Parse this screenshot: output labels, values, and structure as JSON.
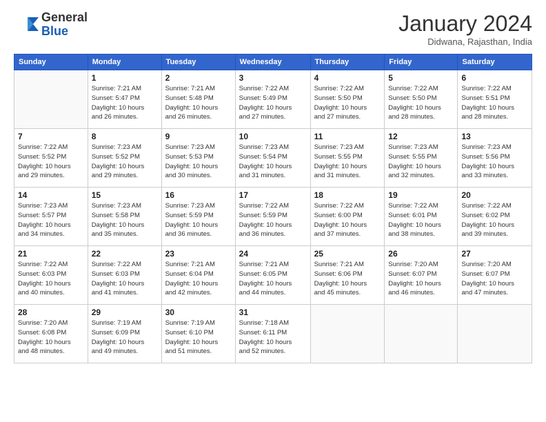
{
  "header": {
    "logo": {
      "line1": "General",
      "line2": "Blue"
    },
    "title": "January 2024",
    "location": "Didwana, Rajasthan, India"
  },
  "weekdays": [
    "Sunday",
    "Monday",
    "Tuesday",
    "Wednesday",
    "Thursday",
    "Friday",
    "Saturday"
  ],
  "weeks": [
    [
      {
        "day": "",
        "info": ""
      },
      {
        "day": "1",
        "info": "Sunrise: 7:21 AM\nSunset: 5:47 PM\nDaylight: 10 hours\nand 26 minutes."
      },
      {
        "day": "2",
        "info": "Sunrise: 7:21 AM\nSunset: 5:48 PM\nDaylight: 10 hours\nand 26 minutes."
      },
      {
        "day": "3",
        "info": "Sunrise: 7:22 AM\nSunset: 5:49 PM\nDaylight: 10 hours\nand 27 minutes."
      },
      {
        "day": "4",
        "info": "Sunrise: 7:22 AM\nSunset: 5:50 PM\nDaylight: 10 hours\nand 27 minutes."
      },
      {
        "day": "5",
        "info": "Sunrise: 7:22 AM\nSunset: 5:50 PM\nDaylight: 10 hours\nand 28 minutes."
      },
      {
        "day": "6",
        "info": "Sunrise: 7:22 AM\nSunset: 5:51 PM\nDaylight: 10 hours\nand 28 minutes."
      }
    ],
    [
      {
        "day": "7",
        "info": "Sunrise: 7:22 AM\nSunset: 5:52 PM\nDaylight: 10 hours\nand 29 minutes."
      },
      {
        "day": "8",
        "info": "Sunrise: 7:23 AM\nSunset: 5:52 PM\nDaylight: 10 hours\nand 29 minutes."
      },
      {
        "day": "9",
        "info": "Sunrise: 7:23 AM\nSunset: 5:53 PM\nDaylight: 10 hours\nand 30 minutes."
      },
      {
        "day": "10",
        "info": "Sunrise: 7:23 AM\nSunset: 5:54 PM\nDaylight: 10 hours\nand 31 minutes."
      },
      {
        "day": "11",
        "info": "Sunrise: 7:23 AM\nSunset: 5:55 PM\nDaylight: 10 hours\nand 31 minutes."
      },
      {
        "day": "12",
        "info": "Sunrise: 7:23 AM\nSunset: 5:55 PM\nDaylight: 10 hours\nand 32 minutes."
      },
      {
        "day": "13",
        "info": "Sunrise: 7:23 AM\nSunset: 5:56 PM\nDaylight: 10 hours\nand 33 minutes."
      }
    ],
    [
      {
        "day": "14",
        "info": "Sunrise: 7:23 AM\nSunset: 5:57 PM\nDaylight: 10 hours\nand 34 minutes."
      },
      {
        "day": "15",
        "info": "Sunrise: 7:23 AM\nSunset: 5:58 PM\nDaylight: 10 hours\nand 35 minutes."
      },
      {
        "day": "16",
        "info": "Sunrise: 7:23 AM\nSunset: 5:59 PM\nDaylight: 10 hours\nand 36 minutes."
      },
      {
        "day": "17",
        "info": "Sunrise: 7:22 AM\nSunset: 5:59 PM\nDaylight: 10 hours\nand 36 minutes."
      },
      {
        "day": "18",
        "info": "Sunrise: 7:22 AM\nSunset: 6:00 PM\nDaylight: 10 hours\nand 37 minutes."
      },
      {
        "day": "19",
        "info": "Sunrise: 7:22 AM\nSunset: 6:01 PM\nDaylight: 10 hours\nand 38 minutes."
      },
      {
        "day": "20",
        "info": "Sunrise: 7:22 AM\nSunset: 6:02 PM\nDaylight: 10 hours\nand 39 minutes."
      }
    ],
    [
      {
        "day": "21",
        "info": "Sunrise: 7:22 AM\nSunset: 6:03 PM\nDaylight: 10 hours\nand 40 minutes."
      },
      {
        "day": "22",
        "info": "Sunrise: 7:22 AM\nSunset: 6:03 PM\nDaylight: 10 hours\nand 41 minutes."
      },
      {
        "day": "23",
        "info": "Sunrise: 7:21 AM\nSunset: 6:04 PM\nDaylight: 10 hours\nand 42 minutes."
      },
      {
        "day": "24",
        "info": "Sunrise: 7:21 AM\nSunset: 6:05 PM\nDaylight: 10 hours\nand 44 minutes."
      },
      {
        "day": "25",
        "info": "Sunrise: 7:21 AM\nSunset: 6:06 PM\nDaylight: 10 hours\nand 45 minutes."
      },
      {
        "day": "26",
        "info": "Sunrise: 7:20 AM\nSunset: 6:07 PM\nDaylight: 10 hours\nand 46 minutes."
      },
      {
        "day": "27",
        "info": "Sunrise: 7:20 AM\nSunset: 6:07 PM\nDaylight: 10 hours\nand 47 minutes."
      }
    ],
    [
      {
        "day": "28",
        "info": "Sunrise: 7:20 AM\nSunset: 6:08 PM\nDaylight: 10 hours\nand 48 minutes."
      },
      {
        "day": "29",
        "info": "Sunrise: 7:19 AM\nSunset: 6:09 PM\nDaylight: 10 hours\nand 49 minutes."
      },
      {
        "day": "30",
        "info": "Sunrise: 7:19 AM\nSunset: 6:10 PM\nDaylight: 10 hours\nand 51 minutes."
      },
      {
        "day": "31",
        "info": "Sunrise: 7:18 AM\nSunset: 6:11 PM\nDaylight: 10 hours\nand 52 minutes."
      },
      {
        "day": "",
        "info": ""
      },
      {
        "day": "",
        "info": ""
      },
      {
        "day": "",
        "info": ""
      }
    ]
  ]
}
